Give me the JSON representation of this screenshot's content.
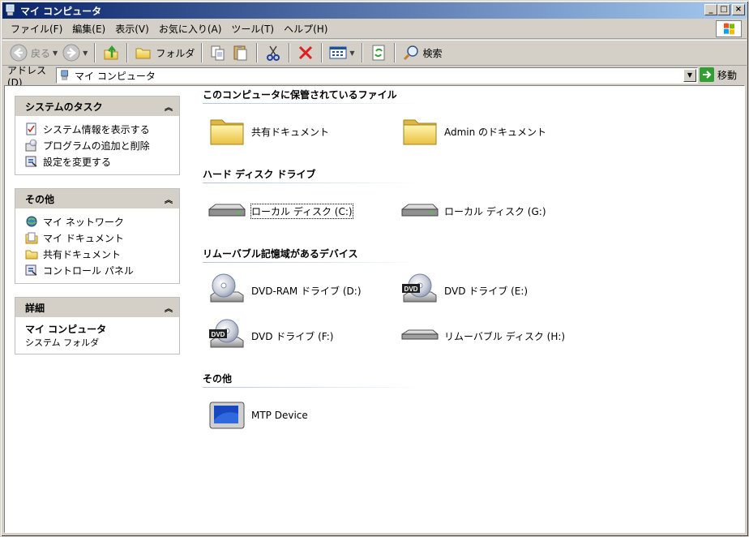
{
  "window": {
    "title": "マイ コンピュータ"
  },
  "menu": [
    "ファイル(F)",
    "編集(E)",
    "表示(V)",
    "お気に入り(A)",
    "ツール(T)",
    "ヘルプ(H)"
  ],
  "toolbar": {
    "back_label": "戻る",
    "folders_label": "フォルダ",
    "search_label": "検索"
  },
  "address": {
    "label": "アドレス(D)",
    "value": "マイ コンピュータ",
    "go_label": "移動"
  },
  "sidebar": {
    "tasks": {
      "title": "システムのタスク",
      "items": [
        {
          "label": "システム情報を表示する",
          "icon": "system-info-icon"
        },
        {
          "label": "プログラムの追加と削除",
          "icon": "add-remove-programs-icon"
        },
        {
          "label": "設定を変更する",
          "icon": "control-panel-icon"
        }
      ]
    },
    "other": {
      "title": "その他",
      "items": [
        {
          "label": "マイ ネットワーク",
          "icon": "network-icon"
        },
        {
          "label": "マイ ドキュメント",
          "icon": "documents-icon"
        },
        {
          "label": "共有ドキュメント",
          "icon": "folder-icon"
        },
        {
          "label": "コントロール パネル",
          "icon": "control-panel-icon"
        }
      ]
    },
    "details": {
      "title": "詳細",
      "name": "マイ コンピュータ",
      "type": "システム フォルダ"
    }
  },
  "groups": [
    {
      "title": "このコンピュータに保管されているファイル",
      "items": [
        {
          "label": "共有ドキュメント",
          "icon": "folder-icon"
        },
        {
          "label": "Admin のドキュメント",
          "icon": "folder-icon"
        }
      ]
    },
    {
      "title": "ハード ディスク ドライブ",
      "items": [
        {
          "label": "ローカル ディスク (C:)",
          "icon": "hard-disk-icon"
        },
        {
          "label": "ローカル ディスク (G:)",
          "icon": "hard-disk-icon"
        }
      ]
    },
    {
      "title": "リムーバブル記憶域があるデバイス",
      "items": [
        {
          "label": "DVD-RAM ドライブ (D:)",
          "icon": "cd-drive-icon"
        },
        {
          "label": "DVD ドライブ (E:)",
          "icon": "dvd-drive-icon"
        },
        {
          "label": "DVD ドライブ (F:)",
          "icon": "dvd-drive-icon"
        },
        {
          "label": "リムーバブル ディスク (H:)",
          "icon": "removable-disk-icon"
        }
      ]
    },
    {
      "title": "その他",
      "items": [
        {
          "label": "MTP Device",
          "icon": "mtp-device-icon"
        }
      ]
    }
  ]
}
